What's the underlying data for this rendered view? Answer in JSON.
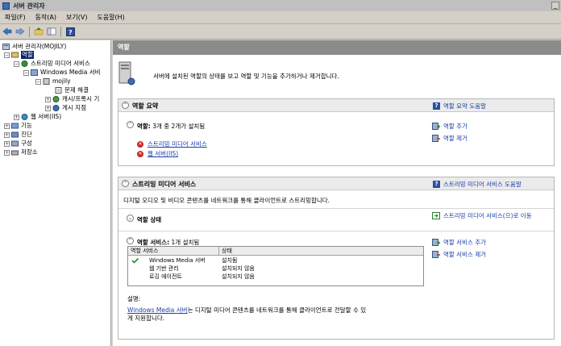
{
  "window": {
    "title": "서버 관리자",
    "minimize_label": "_"
  },
  "menu": [
    "파일(F)",
    "동작(A)",
    "보기(V)",
    "도움말(H)"
  ],
  "toolbar": {
    "icons": [
      "back-arrow-icon",
      "forward-arrow-icon",
      "up-folder-icon",
      "show-hide-tree-icon",
      "help-icon"
    ]
  },
  "tree": {
    "root": "서버 관리자(MOJILY)",
    "roles": "역할",
    "streaming": "스트리밍 미디어 서비스",
    "wms": "Windows Media 서비",
    "mojily": "mojily",
    "troubleshoot": "문제 해결",
    "cache": "캐시/프록시 기",
    "publishing": "게시 지점",
    "iis": "웹 서버(IIS)",
    "features": "기능",
    "diagnostics": "진단",
    "configuration": "구성",
    "storage": "저장소"
  },
  "main": {
    "header": "역할",
    "intro": "서버에 설치된 역할의 상태를 보고 역할 및 기능을 추가하거나 제거합니다.",
    "summary": {
      "title": "역할 요약",
      "help": "역할 요약 도움말",
      "roles_label": "역할:",
      "roles_count": "3개 중 2개가 설치됨",
      "items": [
        "스트리밍 미디어 서비스",
        "웹 서버(IIS)"
      ],
      "add": "역할 추가",
      "remove": "역할 제거"
    },
    "streaming": {
      "title": "스트리밍 미디어 서비스",
      "help": "스트리밍 미디어 서비스 도움말",
      "description": "디지털 오디오 및 비디오 콘텐츠를 네트워크를 통해 클라이언트로 스트리밍합니다.",
      "status_title": "역할 상태",
      "goto": "스트리밍 미디어 서비스(으)로 이동",
      "services_label": "역할 서비스:",
      "services_count": "1개 설치됨",
      "add_service": "역할 서비스 추가",
      "remove_service": "역할 서비스 제거",
      "table": {
        "headers": [
          "역할 서비스",
          "상태"
        ],
        "rows": [
          {
            "name": "Windows Media 서버",
            "status": "설치됨"
          },
          {
            "name": "웹 기반 관리",
            "status": "설치되지 않음"
          },
          {
            "name": "로깅 에이전트",
            "status": "설치되지 않음"
          }
        ]
      },
      "desc_label": "설명:",
      "desc_link": "Windows Media 서버",
      "desc_text": "는 디지털 미디어 콘텐츠를 네트워크를 통해 클라이언트로 전달할 수 있",
      "desc_text2": "게 지원합니다."
    }
  },
  "colors": {
    "accent": "#1a3fa8",
    "header": "#8b8b8b",
    "selection": "#0a246a",
    "error": "#c8282a"
  }
}
